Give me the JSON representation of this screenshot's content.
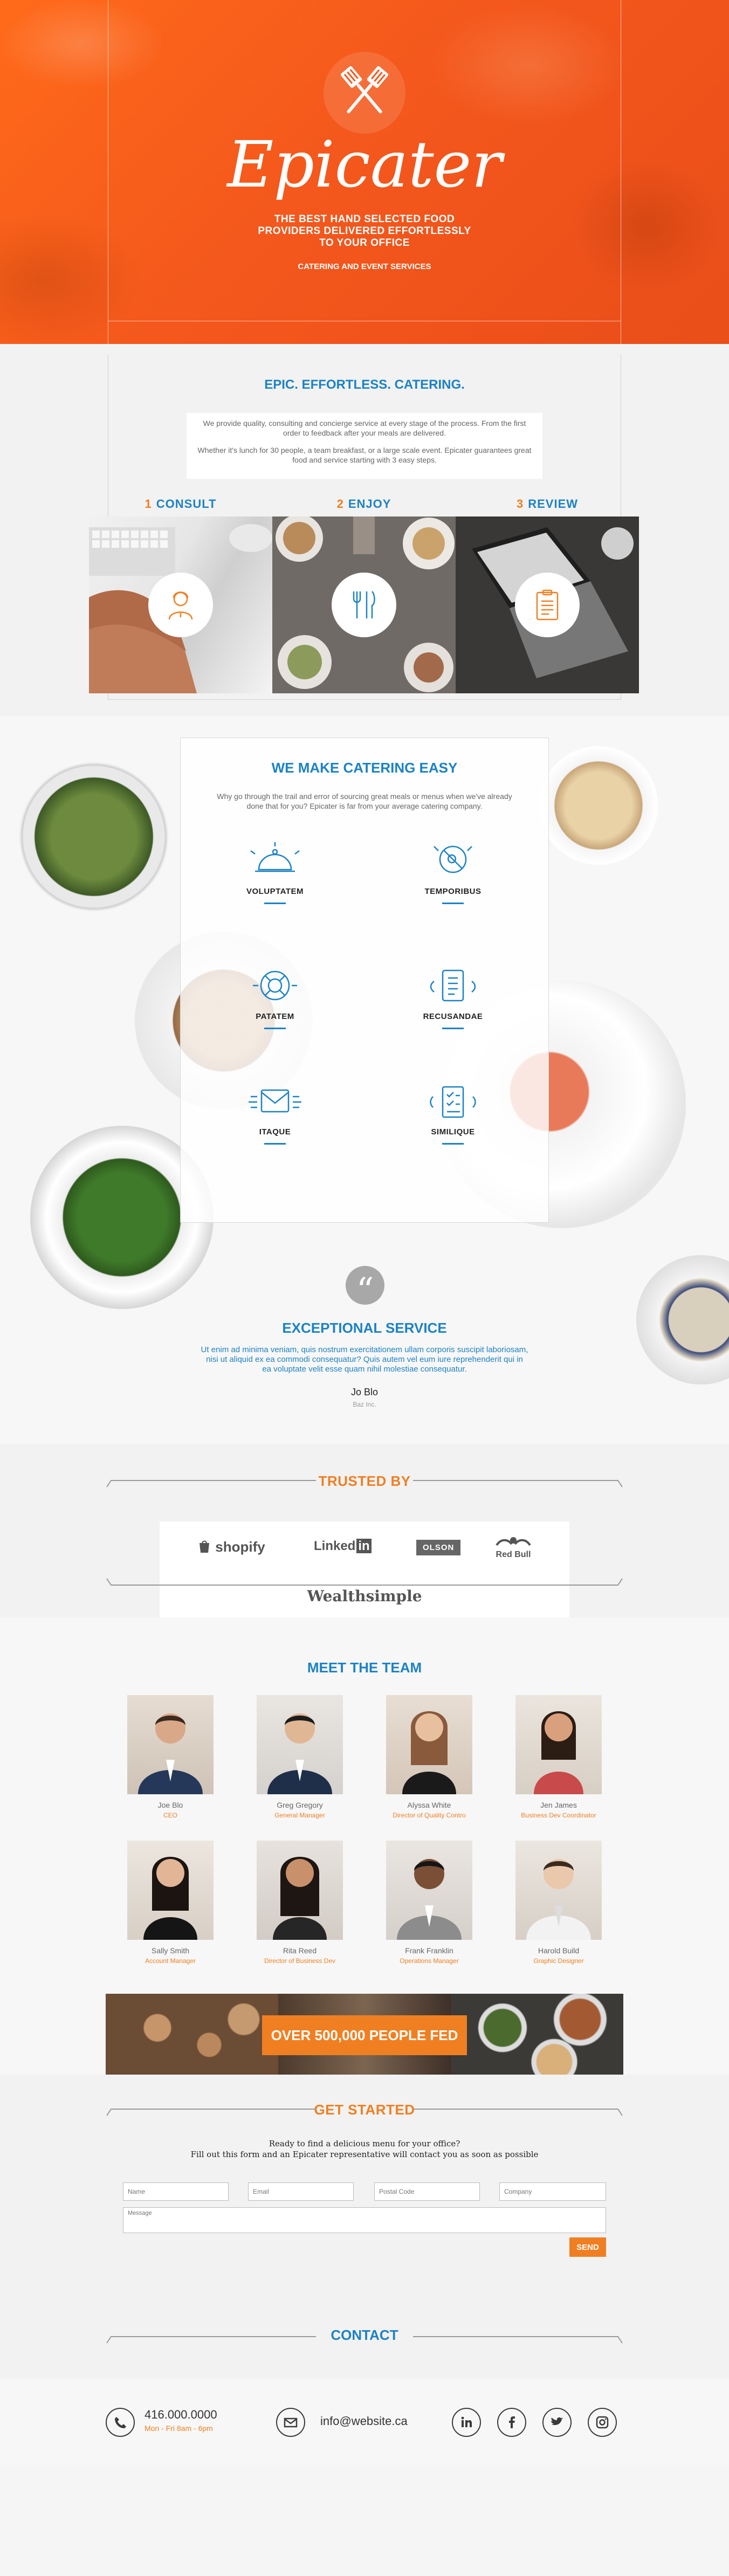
{
  "hero": {
    "brand": "Epicater",
    "tagline": "THE BEST HAND SELECTED FOOD PROVIDERS DELIVERED EFFORTLESSLY TO YOUR OFFICE",
    "sub": "CATERING AND EVENT SERVICES",
    "icon": "spatula-cross-icon"
  },
  "epic": {
    "title": "EPIC. EFFORTLESS. CATERING.",
    "p1": "We provide quality, consulting and concierge service at every stage of the process. From the first order to feedback after your meals are delivered.",
    "p2": "Whether it's lunch for 30 people, a team breakfast, or a large scale event. Epicater guarantees great food and service starting with 3 easy steps.",
    "steps": [
      {
        "num": "1",
        "label": "CONSULT",
        "icon": "consultant-icon"
      },
      {
        "num": "2",
        "label": "ENJOY",
        "icon": "cutlery-icon"
      },
      {
        "num": "3",
        "label": "REVIEW",
        "icon": "clipboard-icon"
      }
    ]
  },
  "catering": {
    "title": "WE MAKE CATERING EASY",
    "desc": "Why go through the trail and error of sourcing great meals or menus when we've already done that for you? Epicater is far from your average catering company.",
    "features": [
      {
        "name": "VOLUPTATEM",
        "icon": "serving-tray-icon"
      },
      {
        "name": "TEMPORIBUS",
        "icon": "no-allergen-icon"
      },
      {
        "name": "PATATEM",
        "icon": "life-ring-icon"
      },
      {
        "name": "RECUSANDAE",
        "icon": "menu-card-icon"
      },
      {
        "name": "ITAQUE",
        "icon": "envelope-icon"
      },
      {
        "name": "SIMILIQUE",
        "icon": "checklist-icon"
      }
    ]
  },
  "service": {
    "quote": "“",
    "title": "EXCEPTIONAL SERVICE",
    "text": "Ut enim ad minima veniam, quis nostrum exercitationem ullam corporis suscipit laboriosam, nisi ut aliquid ex ea commodi consequatur? Quis autem vel eum iure reprehenderit qui in ea voluptate velit esse quam nihil molestiae consequatur.",
    "name": "Jo Blo",
    "company": "Baz Inc."
  },
  "trusted": {
    "title": "TRUSTED BY",
    "logos": [
      "shopify",
      "Linked",
      "in",
      "OLSON",
      "Red Bull",
      "Wealthsimple"
    ]
  },
  "team": {
    "title": "MEET THE TEAM",
    "members": [
      {
        "name": "Joe Blo",
        "role": "CEO"
      },
      {
        "name": "Greg Gregory",
        "role": "General Manager"
      },
      {
        "name": "Alyssa White",
        "role": "Director of Quality Contro"
      },
      {
        "name": "Jen James",
        "role": "Business Dev Coordinator"
      },
      {
        "name": "Sally Smith",
        "role": "Account Manager"
      },
      {
        "name": "Rita Reed",
        "role": "Director of Business Dev"
      },
      {
        "name": "Frank Franklin",
        "role": "Operations Manager"
      },
      {
        "name": "Harold Build",
        "role": "Graphic Designer"
      }
    ],
    "banner": "OVER 500,000 PEOPLE FED"
  },
  "form": {
    "title": "GET STARTED",
    "intro1": "Ready to find a delicious menu for your office?",
    "intro2": "Fill out this form and an Epicater representative will contact you as soon as possible",
    "name_ph": "Name",
    "email_ph": "Email",
    "postal_ph": "Postal Code",
    "company_ph": "Company",
    "message_ph": "Message",
    "send": "SEND"
  },
  "contact": {
    "title": "CONTACT",
    "phone": "416.000.0000",
    "hours": "Mon - Fri 8am - 6pm",
    "email": "info@website.ca"
  },
  "colors": {
    "orange": "#f07f22",
    "blue": "#1c82c4",
    "hero": "#f4581c"
  }
}
